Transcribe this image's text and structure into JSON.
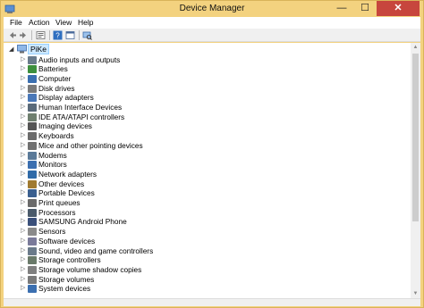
{
  "window": {
    "title": "Device Manager",
    "accent_color": "#f3d27f",
    "close_color": "#c7463d",
    "min_glyph": "—",
    "max_glyph": "☐",
    "close_glyph": "✕"
  },
  "menubar": [
    "File",
    "Action",
    "View",
    "Help"
  ],
  "toolbar": {
    "icons": [
      "back-icon",
      "forward-icon",
      "show-hidden-icon",
      "help-icon",
      "properties-icon",
      "scan-hardware-icon"
    ]
  },
  "tree": {
    "root": {
      "label": "PiKe",
      "expander": "◢",
      "icon": "computer-icon"
    },
    "collapsed_glyph": "▷",
    "categories": [
      {
        "label": "Audio inputs and outputs",
        "icon": "speaker-icon",
        "color": "#6a7b8c"
      },
      {
        "label": "Batteries",
        "icon": "battery-icon",
        "color": "#3d8f3d"
      },
      {
        "label": "Computer",
        "icon": "computer-icon",
        "color": "#3b6fb0"
      },
      {
        "label": "Disk drives",
        "icon": "disk-icon",
        "color": "#7a7a7a"
      },
      {
        "label": "Display adapters",
        "icon": "display-adapter-icon",
        "color": "#4a78b8"
      },
      {
        "label": "Human Interface Devices",
        "icon": "hid-icon",
        "color": "#5a6a7a"
      },
      {
        "label": "IDE ATA/ATAPI controllers",
        "icon": "ide-controller-icon",
        "color": "#6f7f6f"
      },
      {
        "label": "Imaging devices",
        "icon": "camera-icon",
        "color": "#555555"
      },
      {
        "label": "Keyboards",
        "icon": "keyboard-icon",
        "color": "#6b6b6b"
      },
      {
        "label": "Mice and other pointing devices",
        "icon": "mouse-icon",
        "color": "#707070"
      },
      {
        "label": "Modems",
        "icon": "modem-icon",
        "color": "#5b7a99"
      },
      {
        "label": "Monitors",
        "icon": "monitor-icon",
        "color": "#3b6fb0"
      },
      {
        "label": "Network adapters",
        "icon": "network-adapter-icon",
        "color": "#2f6aa8"
      },
      {
        "label": "Other devices",
        "icon": "unknown-device-icon",
        "color": "#a07a30"
      },
      {
        "label": "Portable Devices",
        "icon": "portable-device-icon",
        "color": "#3a5f8f"
      },
      {
        "label": "Print queues",
        "icon": "printer-icon",
        "color": "#6a6a6a"
      },
      {
        "label": "Processors",
        "icon": "processor-icon",
        "color": "#4a5a6a"
      },
      {
        "label": "SAMSUNG Android Phone",
        "icon": "phone-icon",
        "color": "#3a4f7a"
      },
      {
        "label": "Sensors",
        "icon": "sensor-icon",
        "color": "#8a8a8a"
      },
      {
        "label": "Software devices",
        "icon": "software-device-icon",
        "color": "#7a7a9a"
      },
      {
        "label": "Sound, video and game controllers",
        "icon": "sound-controller-icon",
        "color": "#6a7a8a"
      },
      {
        "label": "Storage controllers",
        "icon": "storage-controller-icon",
        "color": "#6a7a6a"
      },
      {
        "label": "Storage volume shadow copies",
        "icon": "shadow-copy-icon",
        "color": "#808080"
      },
      {
        "label": "Storage volumes",
        "icon": "storage-volume-icon",
        "color": "#7a7a7a"
      },
      {
        "label": "System devices",
        "icon": "system-device-icon",
        "color": "#3b6fb0"
      }
    ]
  },
  "scrollbar": {
    "up_glyph": "▲",
    "down_glyph": "▼"
  }
}
